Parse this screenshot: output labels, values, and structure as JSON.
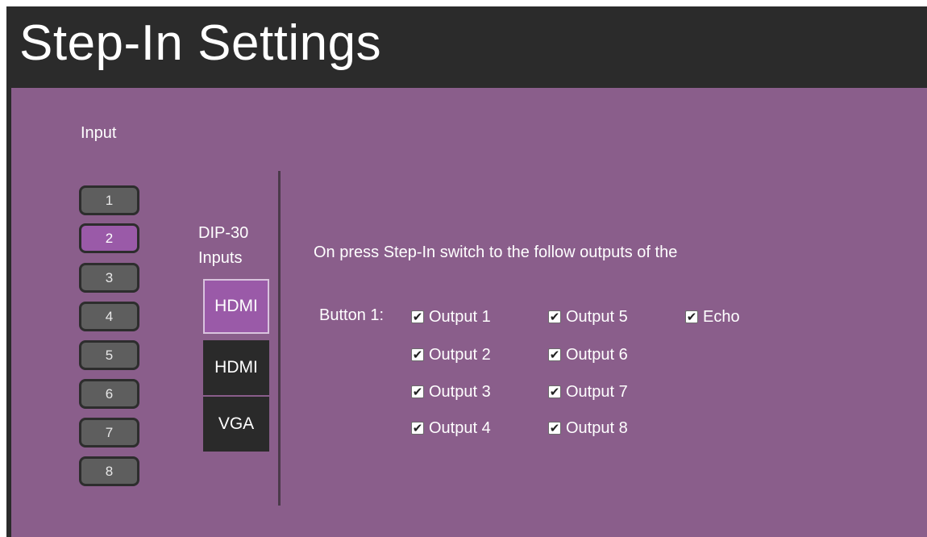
{
  "header": {
    "title": "Step-In Settings"
  },
  "input_section": {
    "title": "Input",
    "buttons": [
      "1",
      "2",
      "3",
      "4",
      "5",
      "6",
      "7",
      "8"
    ],
    "selected": "2"
  },
  "dip": {
    "label_line1": "DIP-30",
    "label_line2": "Inputs",
    "sources": [
      "HDMI",
      "HDMI",
      "VGA"
    ],
    "selected": "HDMI (first)"
  },
  "stepin": {
    "instruction": "On press Step-In switch to the follow outputs of the",
    "button_label": "Button 1:",
    "checkmark_glyph": "✔",
    "options": [
      {
        "label": "Output 1",
        "checked": true
      },
      {
        "label": "Output 2",
        "checked": true
      },
      {
        "label": "Output 3",
        "checked": true
      },
      {
        "label": "Output 4",
        "checked": true
      },
      {
        "label": "Output 5",
        "checked": true
      },
      {
        "label": "Output 6",
        "checked": true
      },
      {
        "label": "Output 7",
        "checked": true
      },
      {
        "label": "Output 8",
        "checked": true
      },
      {
        "label": "Echo",
        "checked": true
      }
    ]
  },
  "colors": {
    "panel": "#8a5e8b",
    "header": "#2b2b2b",
    "active": "#9a5aa8",
    "button": "#5e5e5e"
  }
}
